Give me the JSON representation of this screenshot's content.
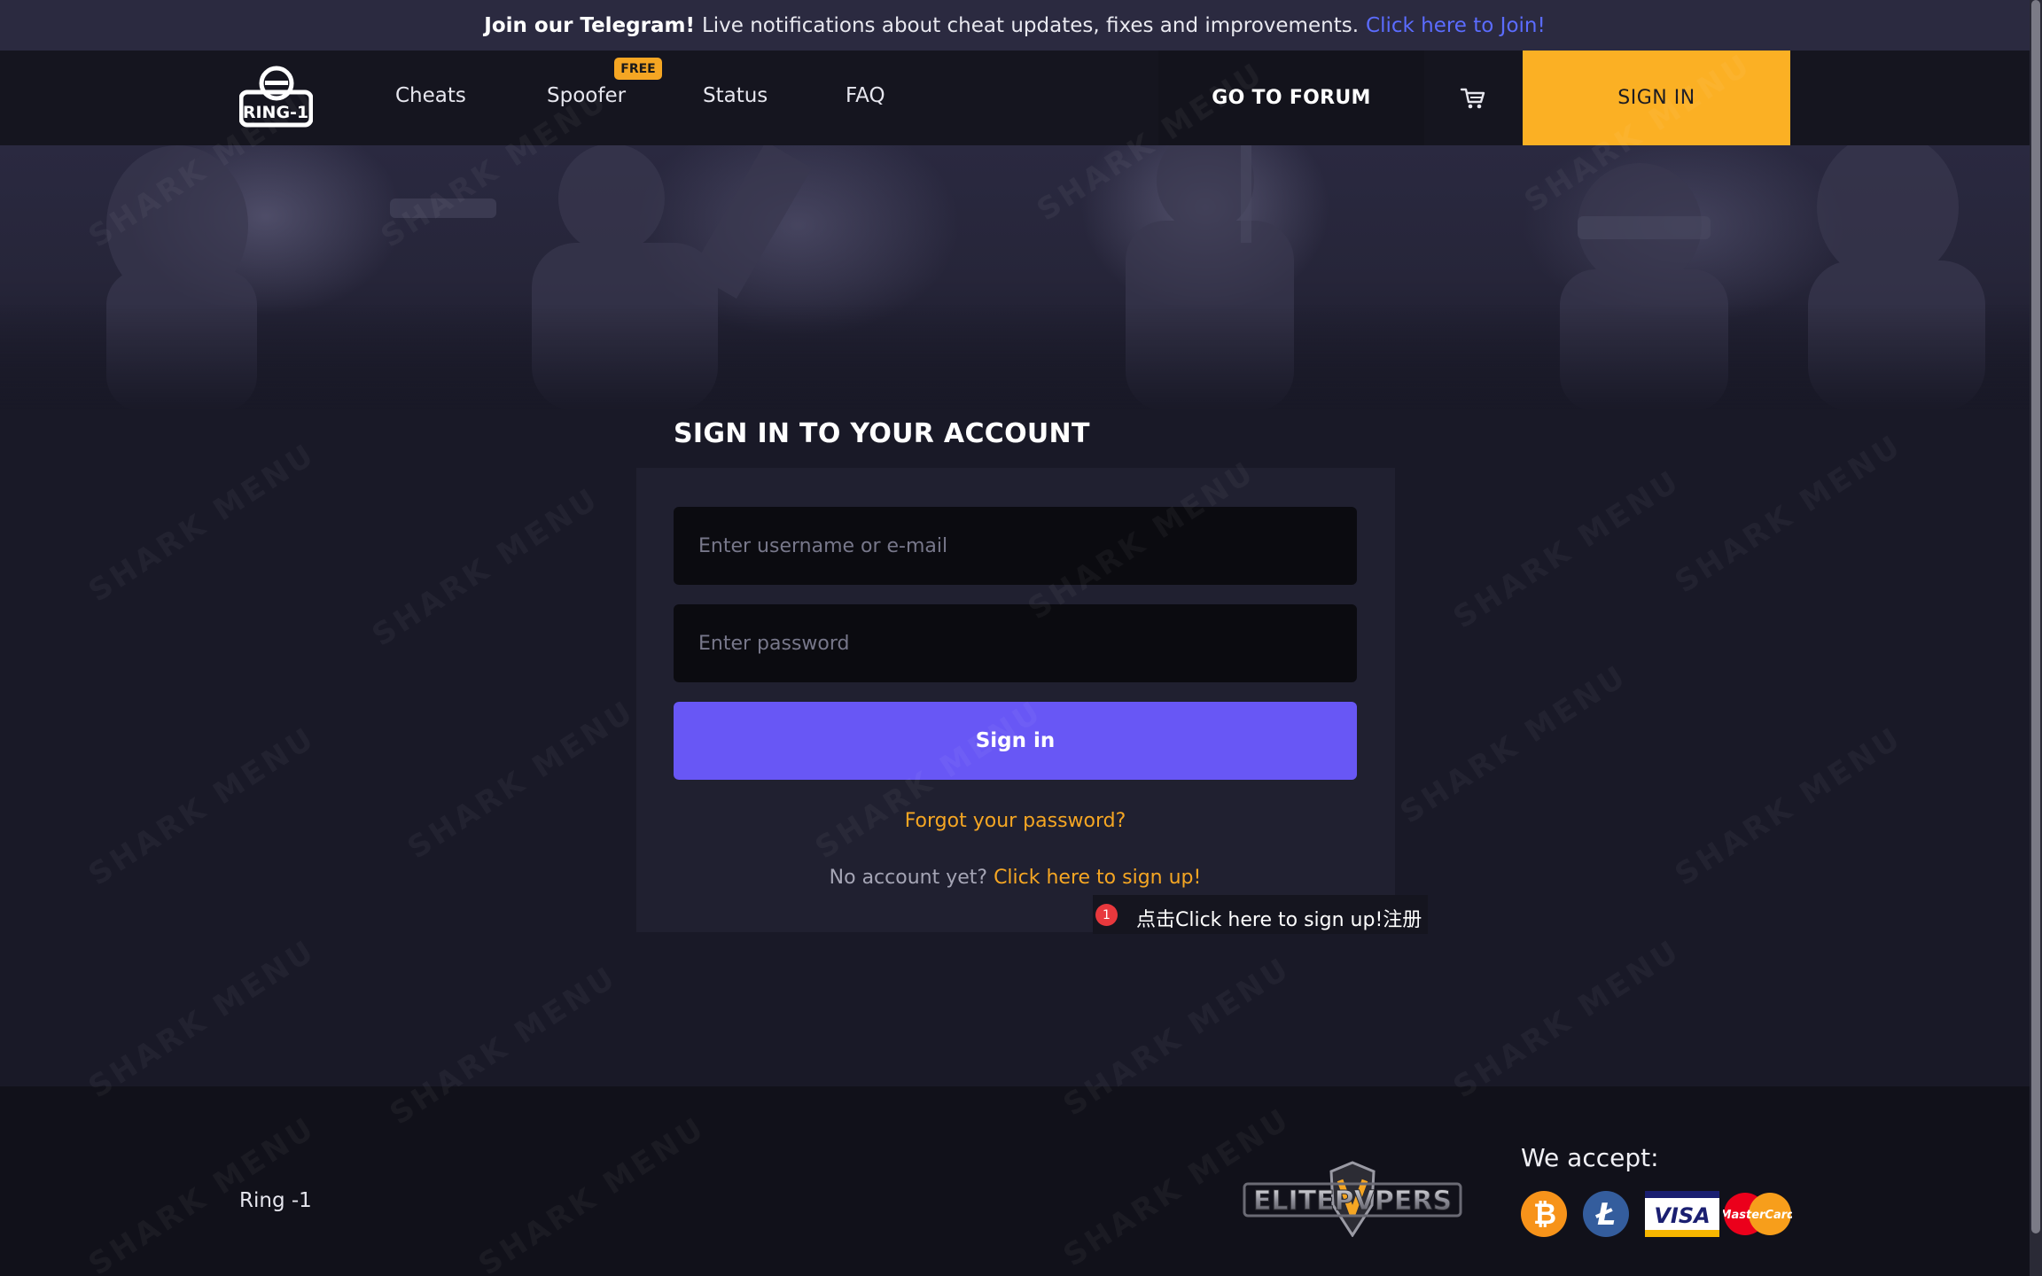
{
  "announcement": {
    "lead": "Join our Telegram!",
    "message": "Live notifications about cheat updates, fixes and improvements.",
    "link": "Click here to Join!"
  },
  "nav": {
    "logo_text": "RING-1",
    "links": [
      "Cheats",
      "Spoofer",
      "Status",
      "FAQ"
    ],
    "free_badge": "FREE",
    "forum": "GO TO FORUM",
    "signin": "SIGN IN"
  },
  "login": {
    "title": "SIGN IN TO YOUR ACCOUNT",
    "username_placeholder": "Enter username or e-mail",
    "password_placeholder": "Enter password",
    "submit": "Sign in",
    "forgot": "Forgot your password?",
    "no_account": "No account yet?",
    "signup": "Click here to sign up!"
  },
  "annotation": {
    "number": "1",
    "text": "点击Click here to sign up!注册"
  },
  "footer": {
    "brand": "Ring -1",
    "partner_logo": "ELITEPVPERS",
    "accept_label": "We accept:",
    "payment_methods": [
      "bitcoin-icon",
      "litecoin-icon",
      "visa-icon",
      "mastercard-icon"
    ],
    "visa_text": "VISA",
    "mastercard_text": "MasterCard"
  },
  "watermark": "SHARK MENU",
  "colors": {
    "accent_yellow": "#fbb024",
    "primary_purple": "#6857f5",
    "link_orange": "#f5a623",
    "link_blue": "#5b6cff"
  }
}
